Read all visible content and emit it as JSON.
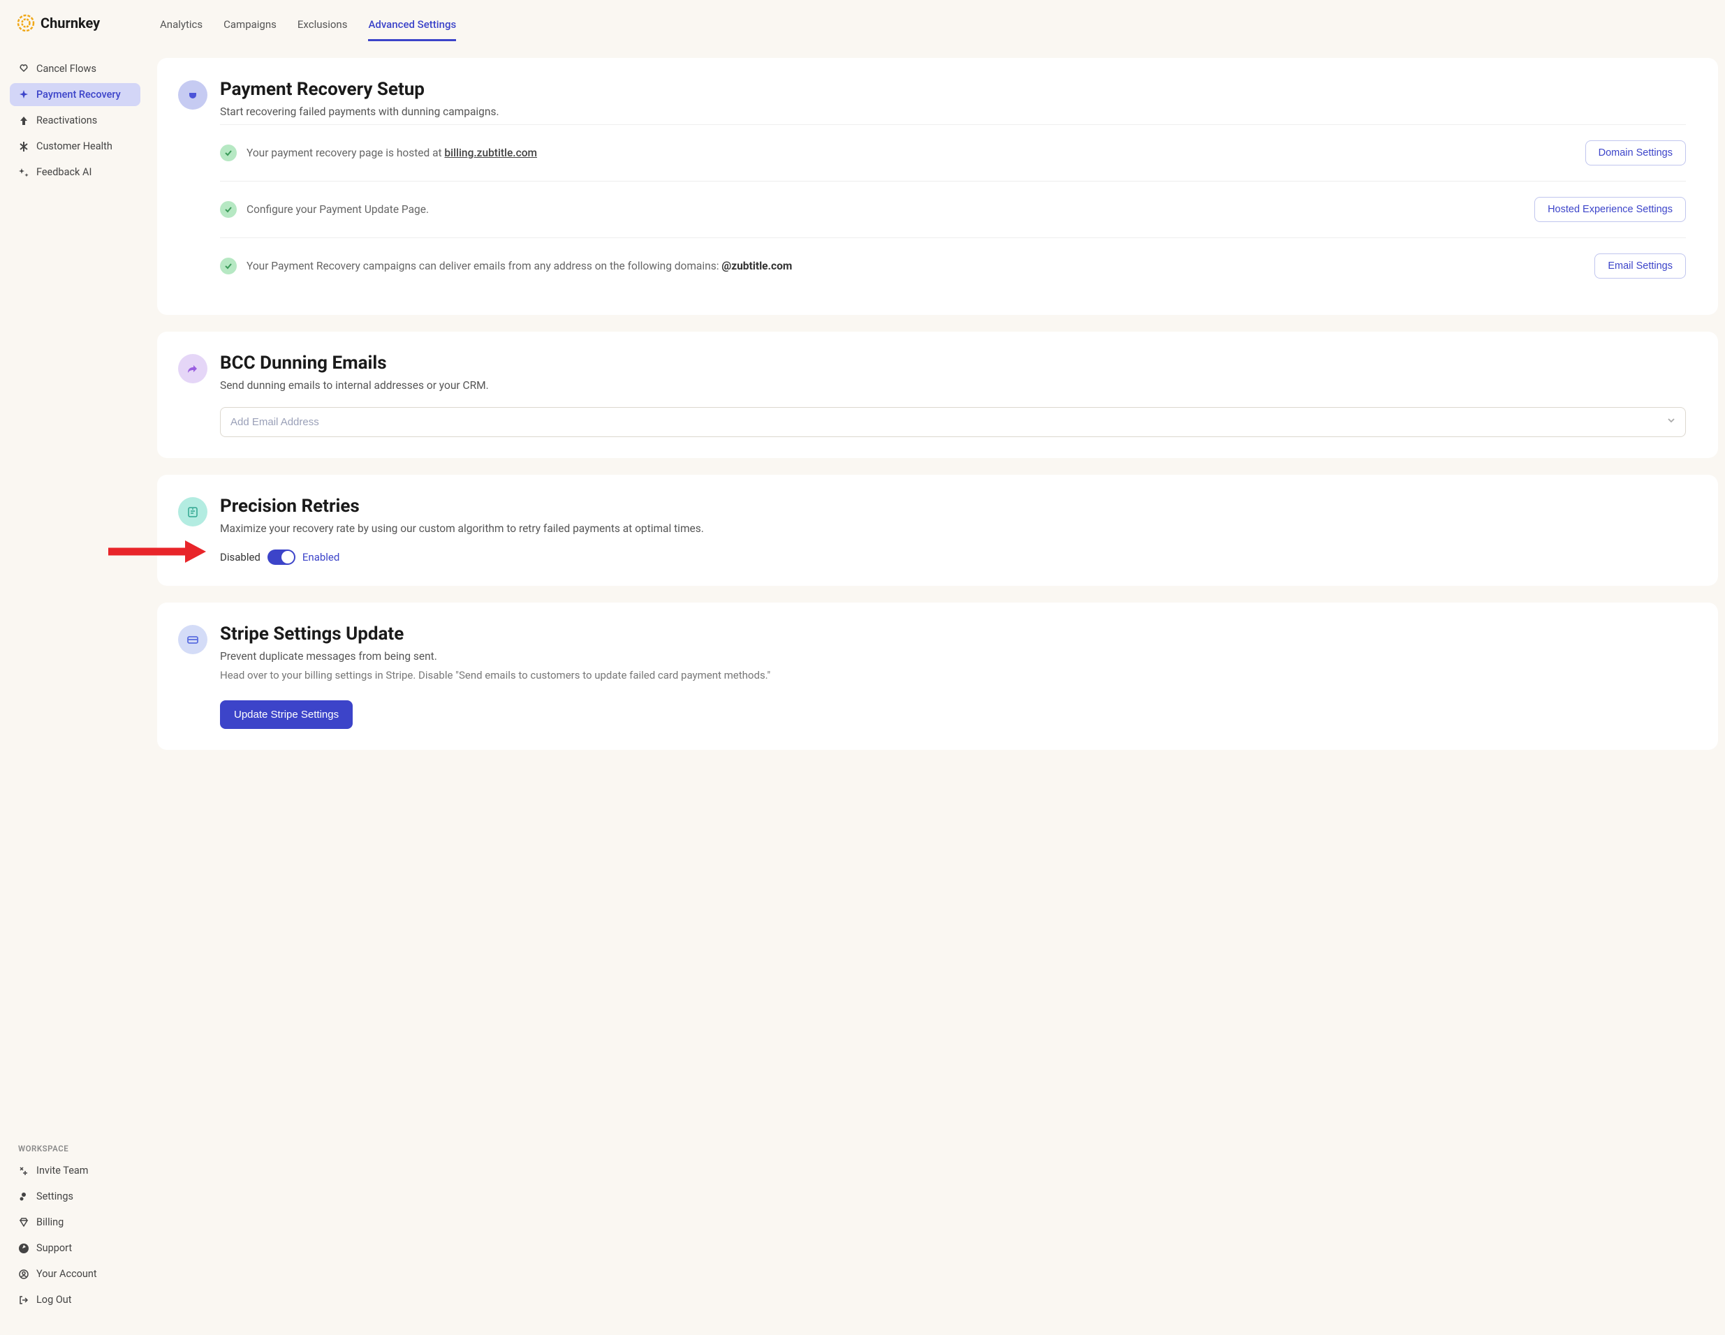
{
  "brand": {
    "name": "Churnkey"
  },
  "sidebar": {
    "nav": [
      {
        "label": "Cancel Flows"
      },
      {
        "label": "Payment Recovery"
      },
      {
        "label": "Reactivations"
      },
      {
        "label": "Customer Health"
      },
      {
        "label": "Feedback AI"
      }
    ],
    "workspace_label": "WORKSPACE",
    "workspace": [
      {
        "label": "Invite Team"
      },
      {
        "label": "Settings"
      },
      {
        "label": "Billing"
      },
      {
        "label": "Support"
      },
      {
        "label": "Your Account"
      },
      {
        "label": "Log Out"
      }
    ]
  },
  "tabs": [
    {
      "label": "Analytics"
    },
    {
      "label": "Campaigns"
    },
    {
      "label": "Exclusions"
    },
    {
      "label": "Advanced Settings"
    }
  ],
  "recovery": {
    "title": "Payment Recovery Setup",
    "desc": "Start recovering failed payments with dunning campaigns.",
    "row1_prefix": "Your payment recovery page is hosted at ",
    "row1_link": "billing.zubtitle.com",
    "row1_btn": "Domain Settings",
    "row2_text": "Configure your Payment Update Page.",
    "row2_btn": "Hosted Experience Settings",
    "row3_prefix": "Your Payment Recovery campaigns can deliver emails from any address on the following domains: ",
    "row3_domain": "@zubtitle.com",
    "row3_btn": "Email Settings"
  },
  "bcc": {
    "title": "BCC Dunning Emails",
    "desc": "Send dunning emails to internal addresses or your CRM.",
    "placeholder": "Add Email Address"
  },
  "retries": {
    "title": "Precision Retries",
    "desc": "Maximize your recovery rate by using our custom algorithm to retry failed payments at optimal times.",
    "disabled_label": "Disabled",
    "enabled_label": "Enabled"
  },
  "stripe": {
    "title": "Stripe Settings Update",
    "desc": "Prevent duplicate messages from being sent.",
    "desc2": "Head over to your billing settings in Stripe. Disable \"Send emails to customers to update failed card payment methods.\"",
    "btn": "Update Stripe Settings"
  }
}
